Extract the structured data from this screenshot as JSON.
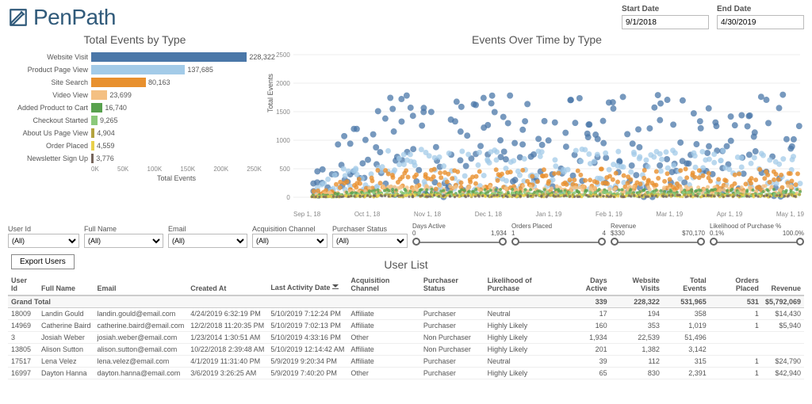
{
  "brand": {
    "name": "PenPath"
  },
  "date_range": {
    "start_label": "Start Date",
    "start_value": "9/1/2018",
    "end_label": "End Date",
    "end_value": "4/30/2019"
  },
  "chart_data": [
    {
      "type": "bar",
      "title": "Total Events by Type",
      "xlabel": "Total Events",
      "xlim": [
        0,
        250000
      ],
      "xticks": [
        "0K",
        "50K",
        "100K",
        "150K",
        "200K",
        "250K"
      ],
      "categories": [
        "Website Visit",
        "Product Page View",
        "Site Search",
        "Video View",
        "Added Product to Cart",
        "Checkout Started",
        "About Us Page View",
        "Order Placed",
        "Newsletter Sign Up"
      ],
      "values": [
        228322,
        137685,
        80163,
        23699,
        16740,
        9265,
        4904,
        4559,
        3776
      ],
      "colors": [
        "#4a77a8",
        "#a3cbe8",
        "#e8902e",
        "#f4c083",
        "#58a14e",
        "#8bc97a",
        "#b3a33e",
        "#e8cf4a",
        "#76655c"
      ]
    },
    {
      "type": "scatter",
      "title": "Events Over Time by Type",
      "ylabel": "Total Events",
      "ylim": [
        0,
        2500
      ],
      "yticks": [
        0,
        500,
        1000,
        1500,
        2000,
        2500
      ],
      "x_categories": [
        "Sep 1, 18",
        "Oct 1, 18",
        "Nov 1, 18",
        "Dec 1, 18",
        "Jan 1, 19",
        "Feb 1, 19",
        "Mar 1, 19",
        "Apr 1, 19",
        "May 1, 19"
      ],
      "note": "dense daily scatter; exact per-point values not labeled in source",
      "series_colors": {
        "Website Visit": "#4a77a8",
        "Product Page View": "#a3cbe8",
        "Site Search": "#e8902e",
        "Video View": "#f4c083",
        "Added Product to Cart": "#58a14e",
        "Checkout Started": "#8bc97a",
        "About Us Page View": "#b3a33e",
        "Order Placed": "#e8cf4a",
        "Newsletter Sign Up": "#76655c"
      }
    }
  ],
  "filters": {
    "user_id": {
      "label": "User Id",
      "value": "(All)"
    },
    "full_name": {
      "label": "Full Name",
      "value": "(All)"
    },
    "email": {
      "label": "Email",
      "value": "(All)"
    },
    "acq_channel": {
      "label": "Acquisition Channel",
      "value": "(All)"
    },
    "purch_status": {
      "label": "Purchaser Status",
      "value": "(All)"
    },
    "days_active": {
      "label": "Days Active",
      "min": "0",
      "max": "1,934"
    },
    "orders_placed": {
      "label": "Orders Placed",
      "min": "1",
      "max": "4"
    },
    "revenue": {
      "label": "Revenue",
      "min": "$330",
      "max": "$70,170"
    },
    "likelihood": {
      "label": "Likelihood of Purchase %",
      "min": "0.1%",
      "max": "100.0%"
    }
  },
  "export_label": "Export Users",
  "user_list_title": "User List",
  "table": {
    "headers": [
      "User Id",
      "Full Name",
      "Email",
      "Created At",
      "Last Activity Date",
      "Acquisition Channel",
      "Purchaser Status",
      "Likelihood of Purchase",
      "Days Active",
      "Website Visits",
      "Total Events",
      "Orders Placed",
      "Revenue"
    ],
    "grand_label": "Grand Total",
    "grand": {
      "days_active": "339",
      "website_visits": "228,322",
      "total_events": "531,965",
      "orders_placed": "531",
      "revenue": "$5,792,069"
    },
    "rows": [
      {
        "user_id": "18009",
        "full_name": "Landin Gould",
        "email": "landin.gould@email.com",
        "created": "4/24/2019 6:32:19 PM",
        "last": "5/10/2019 7:12:24 PM",
        "acq": "Affiliate",
        "status": "Purchaser",
        "like": "Neutral",
        "days": "17",
        "visits": "194",
        "events": "358",
        "orders": "1",
        "rev": "$14,430"
      },
      {
        "user_id": "14969",
        "full_name": "Catherine Baird",
        "email": "catherine.baird@email.com",
        "created": "12/2/2018 11:20:35 PM",
        "last": "5/10/2019 7:02:13 PM",
        "acq": "Affiliate",
        "status": "Purchaser",
        "like": "Highly Likely",
        "days": "160",
        "visits": "353",
        "events": "1,019",
        "orders": "1",
        "rev": "$5,940"
      },
      {
        "user_id": "3",
        "full_name": "Josiah Weber",
        "email": "josiah.weber@email.com",
        "created": "1/23/2014 1:30:51 AM",
        "last": "5/10/2019 4:33:16 PM",
        "acq": "Other",
        "status": "Non Purchaser",
        "like": "Highly Likely",
        "days": "1,934",
        "visits": "22,539",
        "events": "51,496",
        "orders": "",
        "rev": ""
      },
      {
        "user_id": "13805",
        "full_name": "Alison Sutton",
        "email": "alison.sutton@email.com",
        "created": "10/22/2018 2:39:48 AM",
        "last": "5/10/2019 12:14:42 AM",
        "acq": "Affiliate",
        "status": "Non Purchaser",
        "like": "Highly Likely",
        "days": "201",
        "visits": "1,382",
        "events": "3,142",
        "orders": "",
        "rev": ""
      },
      {
        "user_id": "17517",
        "full_name": "Lena Velez",
        "email": "lena.velez@email.com",
        "created": "4/1/2019 11:31:40 PM",
        "last": "5/9/2019 9:20:34 PM",
        "acq": "Affiliate",
        "status": "Purchaser",
        "like": "Neutral",
        "days": "39",
        "visits": "112",
        "events": "315",
        "orders": "1",
        "rev": "$24,790"
      },
      {
        "user_id": "16997",
        "full_name": "Dayton Hanna",
        "email": "dayton.hanna@email.com",
        "created": "3/6/2019 3:26:25 AM",
        "last": "5/9/2019 7:40:20 PM",
        "acq": "Other",
        "status": "Purchaser",
        "like": "Highly Likely",
        "days": "65",
        "visits": "830",
        "events": "2,391",
        "orders": "1",
        "rev": "$42,940"
      }
    ]
  }
}
